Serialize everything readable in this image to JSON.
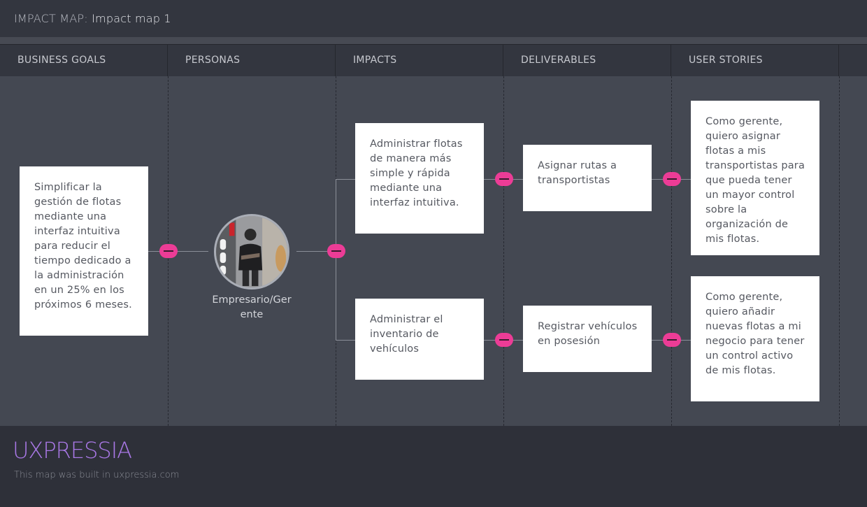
{
  "header": {
    "prefix": "IMPACT MAP:",
    "title": "Impact map 1"
  },
  "columns": [
    "BUSINESS GOALS",
    "PERSONAS",
    "IMPACTS",
    "DELIVERABLES",
    "USER STORIES"
  ],
  "goal": {
    "text": "Simplificar la gestión de flotas mediante una interfaz intuitiva para reducir el tiempo dedicado a la administración en un 25% en los próximos 6 meses."
  },
  "persona": {
    "name": "Empresario/Gerente",
    "avatar_icon": "person-photo-icon"
  },
  "impacts": [
    {
      "text": "Administrar flotas de manera más simple y rápida mediante una interfaz intuitiva."
    },
    {
      "text": "Administrar el inventario de vehículos"
    }
  ],
  "deliverables": [
    {
      "text": "Asignar rutas a transportistas"
    },
    {
      "text": "Registrar vehículos en posesión"
    }
  ],
  "user_stories": [
    {
      "text": "Como gerente, quiero asignar flotas a mis transportistas para que pueda tener un mayor control sobre la organización de mis flotas."
    },
    {
      "text": "Como gerente, quiero añadir nuevas flotas a mi negocio para tener un control activo de mis flotas."
    }
  ],
  "footer": {
    "logo": "UXPRESSIA",
    "credit": "This map was built in uxpressia.com"
  },
  "colors": {
    "accent": "#ec3c96",
    "logo": "#a978e6",
    "canvas": "#444852",
    "card": "#ffffff"
  }
}
